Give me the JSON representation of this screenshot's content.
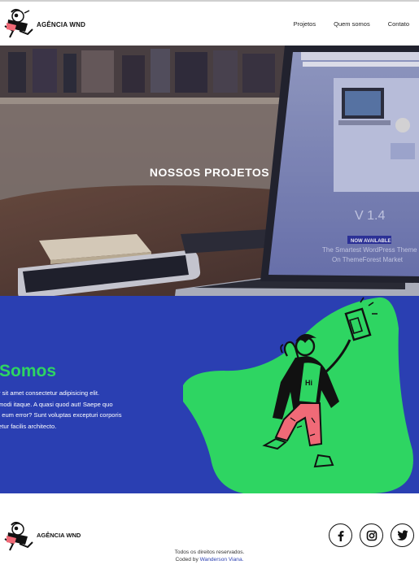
{
  "header": {
    "brand": "AGÊNCIA WND",
    "nav": [
      "Projetos",
      "Quem somos",
      "Contato"
    ]
  },
  "hero": {
    "title": "NOSSOS PROJETOS",
    "screen_badge": "NOW AVAILABLE",
    "screen_caption_1": "The Smartest WordPress Theme",
    "screen_caption_2": "On ThemeForest Market",
    "screen_version": "V 1.4"
  },
  "about": {
    "title": "Somos",
    "text_lines": [
      "r sit amet consectetur adipisicing elit.",
      "modi itaque. A quasi quod aut! Saepe quo",
      "t eum error? Sunt voluptas excepturi corporis",
      "etur facilis architecto."
    ],
    "shirt_text": "Hi"
  },
  "footer": {
    "brand": "AGÊNCIA WND",
    "rights": "Todos os direitos reservados.",
    "coded_by": "Coded by ",
    "author": "Wanderson Viana."
  },
  "colors": {
    "about_bg": "#2a3fb2",
    "accent_green": "#2ed562",
    "pink": "#f06a77"
  }
}
